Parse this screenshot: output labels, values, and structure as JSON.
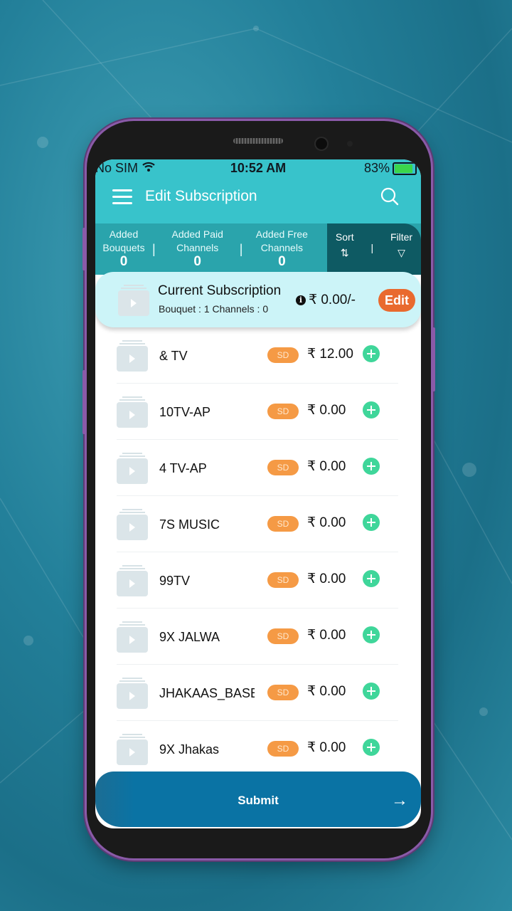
{
  "status_bar": {
    "carrier": "No SIM",
    "time": "10:52 AM",
    "battery": "83%",
    "battery_level": 0.83
  },
  "header": {
    "title": "Edit Subscription",
    "menu_icon": "hamburger-icon",
    "search_icon": "search-icon"
  },
  "stats": [
    {
      "label_line1": "Added",
      "label_line2": "Bouquets",
      "value": "0"
    },
    {
      "label_line1": "Added Paid",
      "label_line2": "Channels",
      "value": "0"
    },
    {
      "label_line1": "Added Free",
      "label_line2": "Channels",
      "value": "0"
    }
  ],
  "sort": {
    "label": "Sort",
    "icon": "⇅"
  },
  "filter": {
    "label": "Filter",
    "icon": "▽"
  },
  "separator": "|",
  "current_subscription": {
    "title": "Current Subscription",
    "subtitle": "Bouquet : 1  Channels : 0",
    "info_icon": "i",
    "price": "₹ 0.00/-",
    "edit_label": "Edit"
  },
  "channels": [
    {
      "name": "& TV",
      "quality": "SD",
      "price": "₹ 12.00"
    },
    {
      "name": "10TV-AP",
      "quality": "SD",
      "price": "₹ 0.00"
    },
    {
      "name": "4 TV-AP",
      "quality": "SD",
      "price": "₹ 0.00"
    },
    {
      "name": "7S MUSIC",
      "quality": "SD",
      "price": "₹ 0.00"
    },
    {
      "name": "99TV",
      "quality": "SD",
      "price": "₹ 0.00"
    },
    {
      "name": "9X JALWA",
      "quality": "SD",
      "price": "₹ 0.00"
    },
    {
      "name": "JHAKAAS_BASE",
      "quality": "SD",
      "price": "₹ 0.00"
    },
    {
      "name": "9X Jhakas",
      "quality": "SD",
      "price": "₹ 0.00"
    }
  ],
  "submit": {
    "label": "Submit",
    "arrow": "→"
  },
  "colors": {
    "header": "#38c3cb",
    "stats_bar": "#2aa4ac",
    "sort_filter_bg": "#0e5a63",
    "current_bg": "#ccf4f8",
    "edit_button": "#e96a2f",
    "sd_badge": "#f59a45",
    "add_button": "#3fd69a",
    "submit": "#0a73a4"
  }
}
